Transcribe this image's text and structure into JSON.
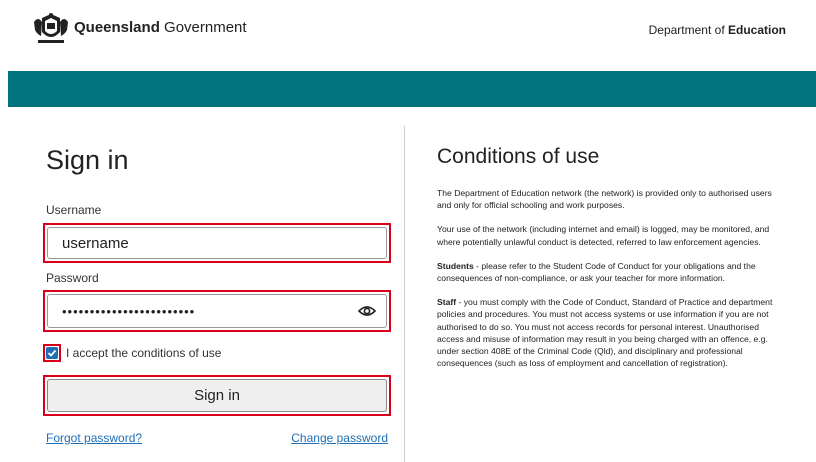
{
  "header": {
    "brand_bold": "Queensland",
    "brand_rest": " Government",
    "dept_prefix": "Department of ",
    "dept_bold": "Education"
  },
  "signin": {
    "title": "Sign in",
    "username_label": "Username",
    "username_value": "username",
    "password_label": "Password",
    "password_value": "••••••••••••••••••••••••",
    "accept_checked": true,
    "accept_label": "I accept the conditions of use",
    "signin_button": "Sign in",
    "forgot_link": "Forgot password?",
    "change_link": "Change password"
  },
  "conditions": {
    "title": "Conditions of use",
    "p1": "The Department of Education network (the network) is provided only to authorised users and only for official schooling and work purposes.",
    "p2": "Your use of the network (including internet and email) is logged, may be monitored, and where potentially unlawful conduct is detected, referred to law enforcement agencies.",
    "p3_bold": "Students",
    "p3_rest": " - please refer to the Student Code of Conduct for your obligations and the consequences of non-compliance, or ask your teacher for more information.",
    "p4_bold": "Staff",
    "p4_rest": " - you must comply with the Code of Conduct, Standard of Practice and department policies and procedures. You must not access systems or use information if you are not authorised to do so. You must not access records for personal interest. Unauthorised access and misuse of information may result in you being charged with an offence, e.g. under section 408E of the Criminal Code (Qld), and disciplinary and professional consequences (such as loss of employment and cancellation of registration)."
  },
  "colors": {
    "band": "#00737d",
    "highlight": "#d9001b",
    "link": "#1f6fb2"
  },
  "icons": {
    "logo": "queensland-coat-of-arms-icon",
    "password_toggle": "eye-icon",
    "checkbox": "checkmark-icon"
  }
}
